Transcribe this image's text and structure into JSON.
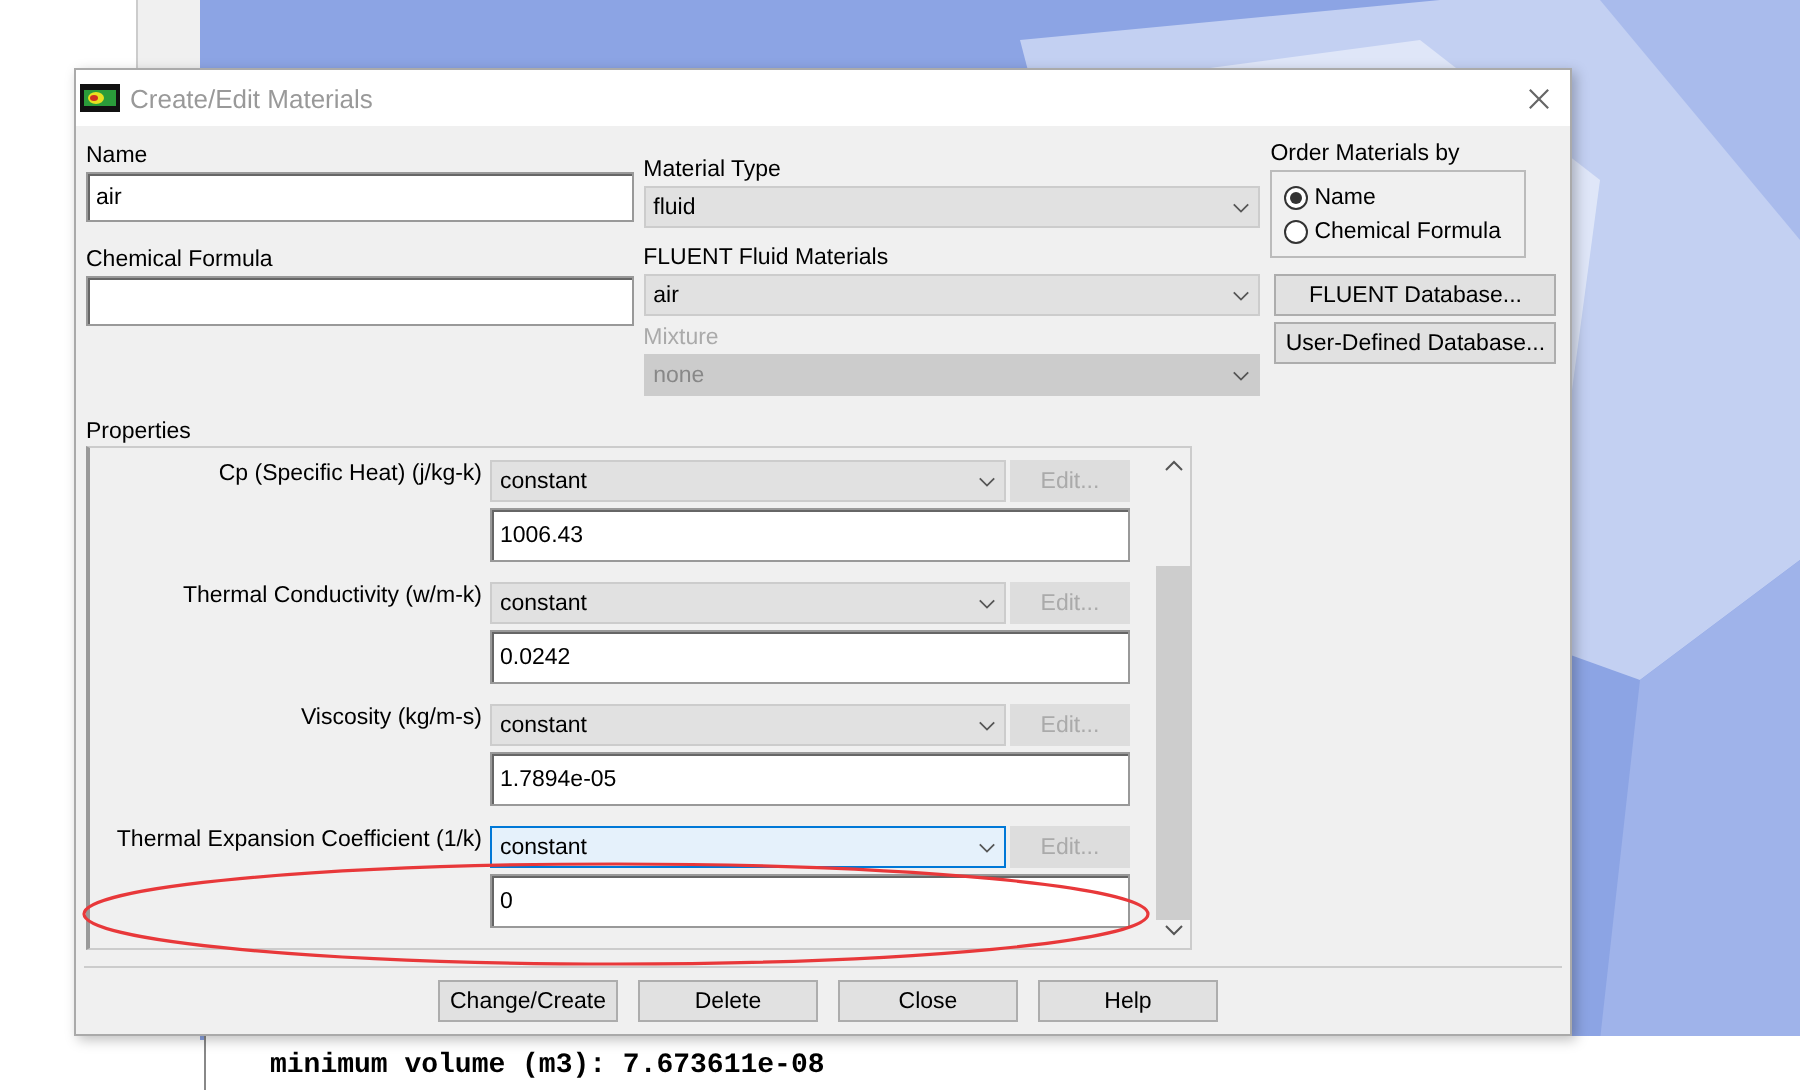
{
  "window": {
    "title": "Create/Edit Materials"
  },
  "name": {
    "label": "Name",
    "value": "air"
  },
  "chemical_formula": {
    "label": "Chemical Formula"
  },
  "material_type": {
    "label": "Material Type",
    "value": "fluid",
    "disabled": false
  },
  "fluent_materials": {
    "label": "FLUENT Fluid Materials",
    "value": "air",
    "disabled": false
  },
  "mixture": {
    "label": "Mixture",
    "value": "none",
    "disabled": true
  },
  "order_by": {
    "label": "Order Materials by",
    "options": [
      {
        "label": "Name",
        "selected": true
      },
      {
        "label": "Chemical Formula",
        "selected": false
      }
    ]
  },
  "database_buttons": [
    "FLUENT Database...",
    "User-Defined Database..."
  ],
  "properties": {
    "label": "Properties",
    "rows": [
      {
        "label": "Cp (Specific Heat) (j/kg-k)",
        "method": "constant",
        "focused": false,
        "edit": "Edit...",
        "edit_disabled": true,
        "value": "1006.43"
      },
      {
        "label": "Thermal Conductivity (w/m-k)",
        "method": "constant",
        "focused": false,
        "edit": "Edit...",
        "edit_disabled": true,
        "value": "0.0242"
      },
      {
        "label": "Viscosity (kg/m-s)",
        "method": "constant",
        "focused": false,
        "edit": "Edit...",
        "edit_disabled": true,
        "value": "1.7894e-05"
      },
      {
        "label": "Thermal Expansion Coefficient (1/k)",
        "method": "constant",
        "focused": true,
        "edit": "Edit...",
        "edit_disabled": true,
        "value": "0"
      }
    ]
  },
  "buttons": [
    "Change/Create",
    "Delete",
    "Close",
    "Help"
  ],
  "console": {
    "lines": [
      "minimum volume (m3): 7.673611e-08"
    ]
  }
}
